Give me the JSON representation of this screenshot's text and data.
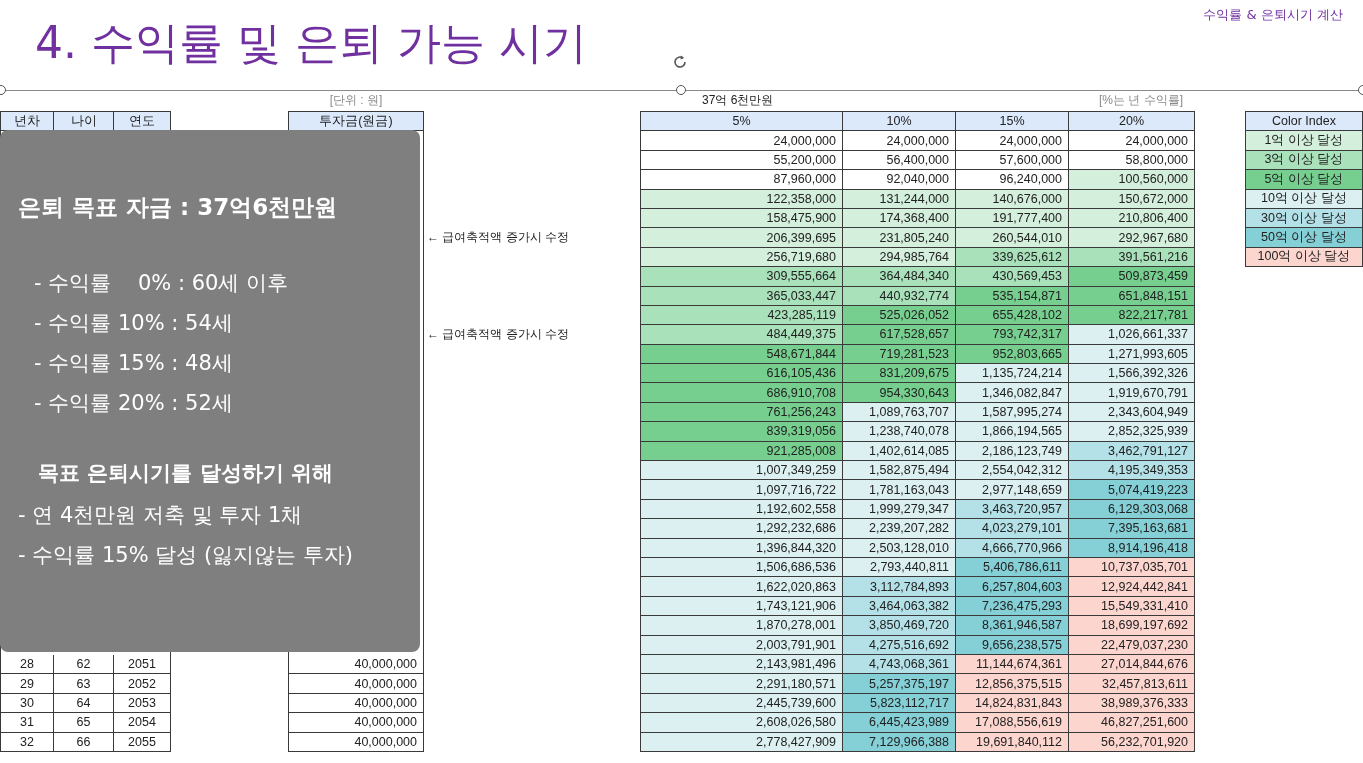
{
  "slide": {
    "title": "4. 수익률 및 은퇴 가능 시기",
    "header_label": "수익률 & 은퇴시기 계산"
  },
  "sheet": {
    "unit_label": "[단위 : 원]",
    "target_label": "37억 6천만원",
    "rate_note": "[%는 년 수익률]",
    "left_table": {
      "columns": [
        "년차",
        "나이",
        "연도"
      ],
      "rows": [
        [
          "28",
          "62",
          "2051"
        ],
        [
          "29",
          "63",
          "2052"
        ],
        [
          "30",
          "64",
          "2053"
        ],
        [
          "31",
          "65",
          "2054"
        ],
        [
          "32",
          "66",
          "2055"
        ]
      ]
    },
    "investment": {
      "column": "투자금(원금)",
      "rows": [
        "40,000,000",
        "40,000,000",
        "40,000,000",
        "40,000,000",
        "40,000,000"
      ]
    },
    "notes": [
      "← 급여축적액 증가시 수정",
      "← 급여축적액 증가시 수정"
    ],
    "results": {
      "columns": [
        "5%",
        "10%",
        "15%",
        "20%"
      ],
      "rows": [
        [
          {
            "text": "24,000,000",
            "color": "#ffffff"
          },
          {
            "text": "24,000,000",
            "color": "#ffffff"
          },
          {
            "text": "24,000,000",
            "color": "#ffffff"
          },
          {
            "text": "24,000,000",
            "color": "#ffffff"
          }
        ],
        [
          {
            "text": "55,200,000",
            "color": "#ffffff"
          },
          {
            "text": "56,400,000",
            "color": "#ffffff"
          },
          {
            "text": "57,600,000",
            "color": "#ffffff"
          },
          {
            "text": "58,800,000",
            "color": "#ffffff"
          }
        ],
        [
          {
            "text": "87,960,000",
            "color": "#ffffff"
          },
          {
            "text": "92,040,000",
            "color": "#ffffff"
          },
          {
            "text": "96,240,000",
            "color": "#ffffff"
          },
          {
            "text": "100,560,000",
            "color": "#d4efdc"
          }
        ],
        [
          {
            "text": "122,358,000",
            "color": "#d4efdc"
          },
          {
            "text": "131,244,000",
            "color": "#d4efdc"
          },
          {
            "text": "140,676,000",
            "color": "#d4efdc"
          },
          {
            "text": "150,672,000",
            "color": "#d4efdc"
          }
        ],
        [
          {
            "text": "158,475,900",
            "color": "#d4efdc"
          },
          {
            "text": "174,368,400",
            "color": "#d4efdc"
          },
          {
            "text": "191,777,400",
            "color": "#d4efdc"
          },
          {
            "text": "210,806,400",
            "color": "#d4efdc"
          }
        ],
        [
          {
            "text": "206,399,695",
            "color": "#d4efdc"
          },
          {
            "text": "231,805,240",
            "color": "#d4efdc"
          },
          {
            "text": "260,544,010",
            "color": "#d4efdc"
          },
          {
            "text": "292,967,680",
            "color": "#d4efdc"
          }
        ],
        [
          {
            "text": "256,719,680",
            "color": "#d4efdc"
          },
          {
            "text": "294,985,764",
            "color": "#d4efdc"
          },
          {
            "text": "339,625,612",
            "color": "#a9e1ba"
          },
          {
            "text": "391,561,216",
            "color": "#a9e1ba"
          }
        ],
        [
          {
            "text": "309,555,664",
            "color": "#a9e1ba"
          },
          {
            "text": "364,484,340",
            "color": "#a9e1ba"
          },
          {
            "text": "430,569,453",
            "color": "#a9e1ba"
          },
          {
            "text": "509,873,459",
            "color": "#76cf8f"
          }
        ],
        [
          {
            "text": "365,033,447",
            "color": "#a9e1ba"
          },
          {
            "text": "440,932,774",
            "color": "#a9e1ba"
          },
          {
            "text": "535,154,871",
            "color": "#76cf8f"
          },
          {
            "text": "651,848,151",
            "color": "#76cf8f"
          }
        ],
        [
          {
            "text": "423,285,119",
            "color": "#a9e1ba"
          },
          {
            "text": "525,026,052",
            "color": "#76cf8f"
          },
          {
            "text": "655,428,102",
            "color": "#76cf8f"
          },
          {
            "text": "822,217,781",
            "color": "#76cf8f"
          }
        ],
        [
          {
            "text": "484,449,375",
            "color": "#a9e1ba"
          },
          {
            "text": "617,528,657",
            "color": "#76cf8f"
          },
          {
            "text": "793,742,317",
            "color": "#76cf8f"
          },
          {
            "text": "1,026,661,337",
            "color": "#dcf0f2"
          }
        ],
        [
          {
            "text": "548,671,844",
            "color": "#76cf8f"
          },
          {
            "text": "719,281,523",
            "color": "#76cf8f"
          },
          {
            "text": "952,803,665",
            "color": "#76cf8f"
          },
          {
            "text": "1,271,993,605",
            "color": "#dcf0f2"
          }
        ],
        [
          {
            "text": "616,105,436",
            "color": "#76cf8f"
          },
          {
            "text": "831,209,675",
            "color": "#76cf8f"
          },
          {
            "text": "1,135,724,214",
            "color": "#dcf0f2"
          },
          {
            "text": "1,566,392,326",
            "color": "#dcf0f2"
          }
        ],
        [
          {
            "text": "686,910,708",
            "color": "#76cf8f"
          },
          {
            "text": "954,330,643",
            "color": "#76cf8f"
          },
          {
            "text": "1,346,082,847",
            "color": "#dcf0f2"
          },
          {
            "text": "1,919,670,791",
            "color": "#dcf0f2"
          }
        ],
        [
          {
            "text": "761,256,243",
            "color": "#76cf8f"
          },
          {
            "text": "1,089,763,707",
            "color": "#dcf0f2"
          },
          {
            "text": "1,587,995,274",
            "color": "#dcf0f2"
          },
          {
            "text": "2,343,604,949",
            "color": "#dcf0f2"
          }
        ],
        [
          {
            "text": "839,319,056",
            "color": "#76cf8f"
          },
          {
            "text": "1,238,740,078",
            "color": "#dcf0f2"
          },
          {
            "text": "1,866,194,565",
            "color": "#dcf0f2"
          },
          {
            "text": "2,852,325,939",
            "color": "#dcf0f2"
          }
        ],
        [
          {
            "text": "921,285,008",
            "color": "#76cf8f"
          },
          {
            "text": "1,402,614,085",
            "color": "#dcf0f2"
          },
          {
            "text": "2,186,123,749",
            "color": "#dcf0f2"
          },
          {
            "text": "3,462,791,127",
            "color": "#b3e1e7"
          }
        ],
        [
          {
            "text": "1,007,349,259",
            "color": "#dcf0f2"
          },
          {
            "text": "1,582,875,494",
            "color": "#dcf0f2"
          },
          {
            "text": "2,554,042,312",
            "color": "#dcf0f2"
          },
          {
            "text": "4,195,349,353",
            "color": "#b3e1e7"
          }
        ],
        [
          {
            "text": "1,097,716,722",
            "color": "#dcf0f2"
          },
          {
            "text": "1,781,163,043",
            "color": "#dcf0f2"
          },
          {
            "text": "2,977,148,659",
            "color": "#dcf0f2"
          },
          {
            "text": "5,074,419,223",
            "color": "#85cfd6"
          }
        ],
        [
          {
            "text": "1,192,602,558",
            "color": "#dcf0f2"
          },
          {
            "text": "1,999,279,347",
            "color": "#dcf0f2"
          },
          {
            "text": "3,463,720,957",
            "color": "#b3e1e7"
          },
          {
            "text": "6,129,303,068",
            "color": "#85cfd6"
          }
        ],
        [
          {
            "text": "1,292,232,686",
            "color": "#dcf0f2"
          },
          {
            "text": "2,239,207,282",
            "color": "#dcf0f2"
          },
          {
            "text": "4,023,279,101",
            "color": "#b3e1e7"
          },
          {
            "text": "7,395,163,681",
            "color": "#85cfd6"
          }
        ],
        [
          {
            "text": "1,396,844,320",
            "color": "#dcf0f2"
          },
          {
            "text": "2,503,128,010",
            "color": "#dcf0f2"
          },
          {
            "text": "4,666,770,966",
            "color": "#b3e1e7"
          },
          {
            "text": "8,914,196,418",
            "color": "#85cfd6"
          }
        ],
        [
          {
            "text": "1,506,686,536",
            "color": "#dcf0f2"
          },
          {
            "text": "2,793,440,811",
            "color": "#dcf0f2"
          },
          {
            "text": "5,406,786,611",
            "color": "#85cfd6"
          },
          {
            "text": "10,737,035,701",
            "color": "#fcd5cf"
          }
        ],
        [
          {
            "text": "1,622,020,863",
            "color": "#dcf0f2"
          },
          {
            "text": "3,112,784,893",
            "color": "#b3e1e7"
          },
          {
            "text": "6,257,804,603",
            "color": "#85cfd6"
          },
          {
            "text": "12,924,442,841",
            "color": "#fcd5cf"
          }
        ],
        [
          {
            "text": "1,743,121,906",
            "color": "#dcf0f2"
          },
          {
            "text": "3,464,063,382",
            "color": "#b3e1e7"
          },
          {
            "text": "7,236,475,293",
            "color": "#85cfd6"
          },
          {
            "text": "15,549,331,410",
            "color": "#fcd5cf"
          }
        ],
        [
          {
            "text": "1,870,278,001",
            "color": "#dcf0f2"
          },
          {
            "text": "3,850,469,720",
            "color": "#b3e1e7"
          },
          {
            "text": "8,361,946,587",
            "color": "#85cfd6"
          },
          {
            "text": "18,699,197,692",
            "color": "#fcd5cf"
          }
        ],
        [
          {
            "text": "2,003,791,901",
            "color": "#dcf0f2"
          },
          {
            "text": "4,275,516,692",
            "color": "#b3e1e7"
          },
          {
            "text": "9,656,238,575",
            "color": "#85cfd6"
          },
          {
            "text": "22,479,037,230",
            "color": "#fcd5cf"
          }
        ],
        [
          {
            "text": "2,143,981,496",
            "color": "#dcf0f2"
          },
          {
            "text": "4,743,068,361",
            "color": "#b3e1e7"
          },
          {
            "text": "11,144,674,361",
            "color": "#fcd5cf"
          },
          {
            "text": "27,014,844,676",
            "color": "#fcd5cf"
          }
        ],
        [
          {
            "text": "2,291,180,571",
            "color": "#dcf0f2"
          },
          {
            "text": "5,257,375,197",
            "color": "#85cfd6"
          },
          {
            "text": "12,856,375,515",
            "color": "#fcd5cf"
          },
          {
            "text": "32,457,813,611",
            "color": "#fcd5cf"
          }
        ],
        [
          {
            "text": "2,445,739,600",
            "color": "#dcf0f2"
          },
          {
            "text": "5,823,112,717",
            "color": "#85cfd6"
          },
          {
            "text": "14,824,831,843",
            "color": "#fcd5cf"
          },
          {
            "text": "38,989,376,333",
            "color": "#fcd5cf"
          }
        ],
        [
          {
            "text": "2,608,026,580",
            "color": "#dcf0f2"
          },
          {
            "text": "6,445,423,989",
            "color": "#85cfd6"
          },
          {
            "text": "17,088,556,619",
            "color": "#fcd5cf"
          },
          {
            "text": "46,827,251,600",
            "color": "#fcd5cf"
          }
        ],
        [
          {
            "text": "2,778,427,909",
            "color": "#dcf0f2"
          },
          {
            "text": "7,129,966,388",
            "color": "#85cfd6"
          },
          {
            "text": "19,691,840,112",
            "color": "#fcd5cf"
          },
          {
            "text": "56,232,701,920",
            "color": "#fcd5cf"
          }
        ]
      ]
    },
    "legend": {
      "title": "Color Index",
      "items": [
        {
          "label": "1억 이상 달성",
          "color": "#d4efdc"
        },
        {
          "label": "3억 이상 달성",
          "color": "#a9e1ba"
        },
        {
          "label": "5억 이상 달성",
          "color": "#76cf8f"
        },
        {
          "label": "10억 이상 달성",
          "color": "#dcf0f2"
        },
        {
          "label": "30억 이상 달성",
          "color": "#b3e1e7"
        },
        {
          "label": "50억 이상 달성",
          "color": "#85cfd6"
        },
        {
          "label": "100억 이상 달성",
          "color": "#fcd5cf"
        }
      ]
    }
  },
  "overlay": {
    "heading": "은퇴 목표 자금 : 37억6천만원",
    "lines": [
      "- 수익률    0% : 60세 이후",
      "- 수익률 10% : 54세",
      "- 수익률 15% : 48세",
      "- 수익률 20% : 52세"
    ],
    "subheading": "목표 은퇴시기를 달성하기 위해",
    "points": [
      "- 연 4천만원 저축 및 투자 1채",
      "- 수익률 15% 달성 (잃지않는 투자)"
    ]
  }
}
